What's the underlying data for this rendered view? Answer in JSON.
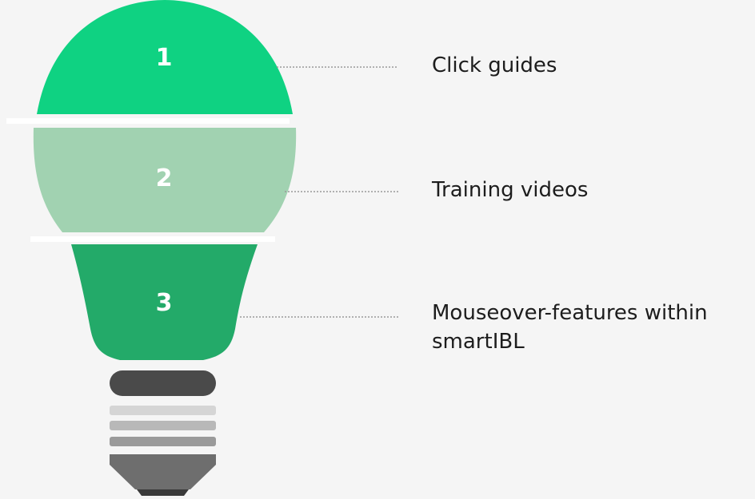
{
  "steps": [
    {
      "number": "1",
      "label": "Click guides"
    },
    {
      "number": "2",
      "label": "Training videos"
    },
    {
      "number": "3",
      "label": "Mouseover-features within\nsmartIBL"
    }
  ],
  "colors": {
    "background": "#f5f5f5",
    "segment_1": "#0fd282",
    "segment_2": "#a1d2b1",
    "segment_3": "#23aa69",
    "connector": "#9a9a9a",
    "base_dark": "#4a4a4a",
    "base_light": "#d5d5d5",
    "base_mid": "#b8b8b8",
    "base_stripe": "#9a9a9a",
    "base_tip": "#6e6e6e"
  },
  "icons": {
    "bulb": "lightbulb-icon",
    "base": "lightbulb-screw-base-icon"
  }
}
